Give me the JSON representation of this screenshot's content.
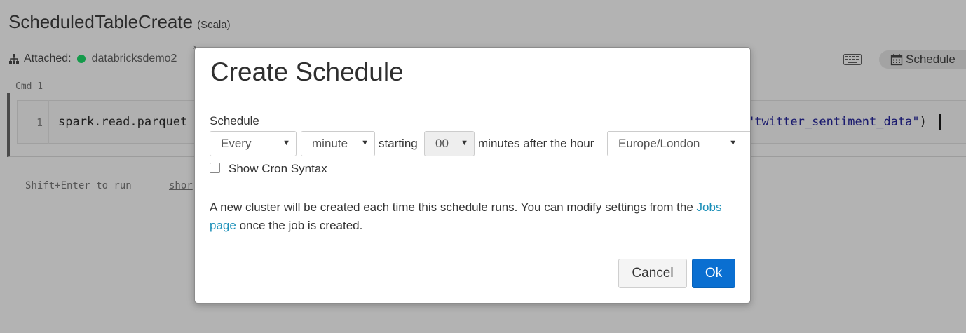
{
  "notebook": {
    "title": "ScheduledTableCreate",
    "language": "(Scala)",
    "attached_label": "Attached:",
    "cluster_name": "databricksdemo2",
    "schedule_button": "Schedule",
    "cmd_label": "Cmd 1",
    "line_number": "1",
    "code_visible_left": "spark.read.parquet",
    "code_string_right": "\"twitter_sentiment_data\"",
    "code_close_paren": ")",
    "run_hint": "Shift+Enter to run",
    "hint_link": "shor",
    "status_color": "#149a4a"
  },
  "modal": {
    "title": "Create Schedule",
    "schedule_label": "Schedule",
    "frequency_select": "Every",
    "unit_select": "minute",
    "starting_text": "starting",
    "minutes_select": "00",
    "after_hour_text": "minutes after the hour",
    "timezone_select": "Europe/London",
    "show_cron_label": "Show Cron Syntax",
    "show_cron_checked": false,
    "info_text_before": "A new cluster will be created each time this schedule runs. You can modify settings from the",
    "info_link": "Jobs page",
    "info_text_after": "once the job is created.",
    "cancel_label": "Cancel",
    "ok_label": "Ok",
    "ok_color": "#0a6fd1",
    "link_color": "#1a8fb8"
  }
}
